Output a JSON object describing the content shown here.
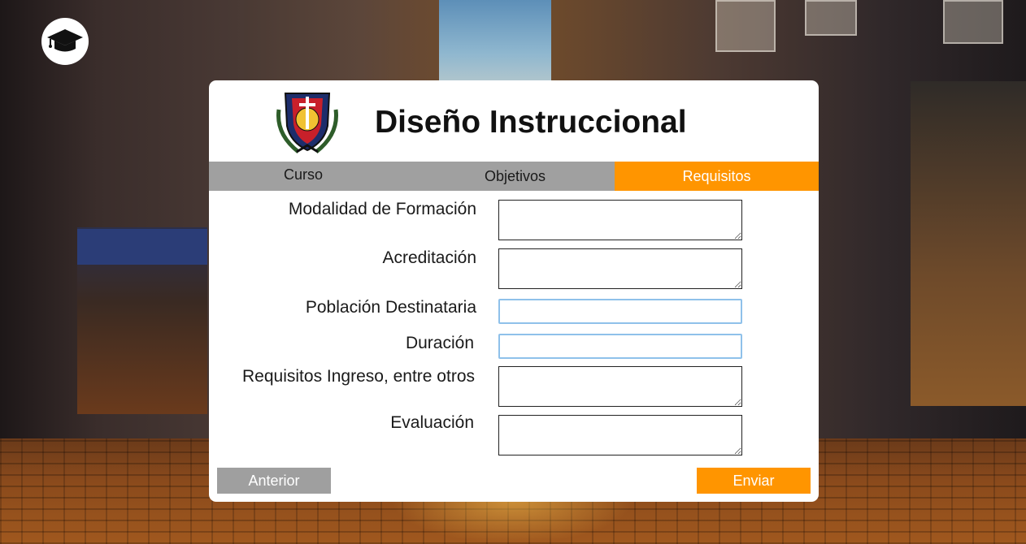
{
  "header": {
    "title": "Diseño Instruccional"
  },
  "tabs": [
    {
      "label": "Curso"
    },
    {
      "label": "Objetivos"
    },
    {
      "label": "Requisitos"
    }
  ],
  "active_tab": "Requisitos",
  "form": {
    "fields": [
      {
        "label": "Modalidad de Formación",
        "value": ""
      },
      {
        "label": "Acreditación",
        "value": ""
      },
      {
        "label": "Población Destinataria",
        "value": ""
      },
      {
        "label": "Duración",
        "value": ""
      },
      {
        "label": "Requisitos Ingreso, entre otros",
        "value": ""
      },
      {
        "label": "Evaluación",
        "value": ""
      }
    ]
  },
  "buttons": {
    "previous": "Anterior",
    "submit": "Enviar"
  },
  "colors": {
    "accent": "#ff9500",
    "tab_bar": "#a0a0a0",
    "secondary_button": "#9f9f9f"
  },
  "icons": {
    "app_logo": "graduation-cap-icon",
    "crest": "school-crest-logo"
  }
}
